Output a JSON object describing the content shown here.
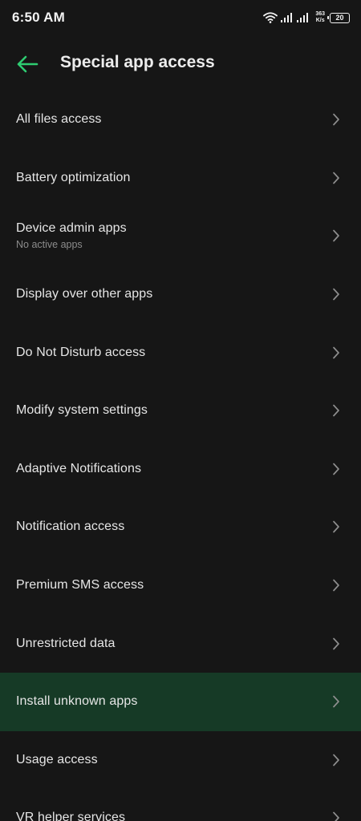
{
  "status_bar": {
    "time": "6:50 AM",
    "net_speed_value": "363",
    "net_speed_unit": "K/s",
    "battery_level": "20"
  },
  "header": {
    "title": "Special app access",
    "back_icon": "arrow-left-icon",
    "accent_color": "#2ecc71"
  },
  "list": {
    "highlight_color": "#163a26",
    "items": [
      {
        "title": "All files access",
        "subtitle": ""
      },
      {
        "title": "Battery optimization",
        "subtitle": ""
      },
      {
        "title": "Device admin apps",
        "subtitle": "No active apps"
      },
      {
        "title": "Display over other apps",
        "subtitle": ""
      },
      {
        "title": "Do Not Disturb access",
        "subtitle": ""
      },
      {
        "title": "Modify system settings",
        "subtitle": ""
      },
      {
        "title": "Adaptive Notifications",
        "subtitle": ""
      },
      {
        "title": "Notification access",
        "subtitle": ""
      },
      {
        "title": "Premium SMS access",
        "subtitle": ""
      },
      {
        "title": "Unrestricted data",
        "subtitle": ""
      },
      {
        "title": "Install unknown apps",
        "subtitle": "",
        "highlighted": true
      },
      {
        "title": "Usage access",
        "subtitle": ""
      },
      {
        "title": "VR helper services",
        "subtitle": ""
      }
    ]
  }
}
